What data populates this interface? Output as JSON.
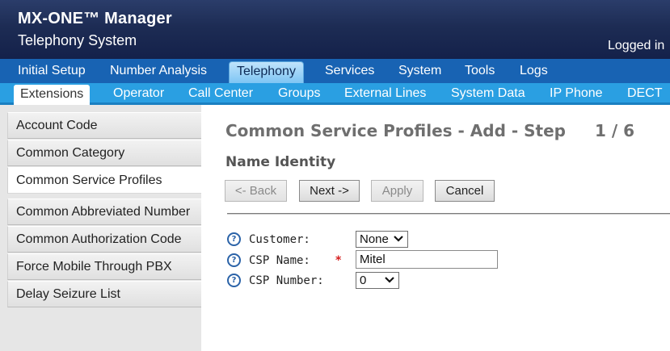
{
  "header": {
    "app_title": "MX-ONE™ Manager",
    "app_subtitle": "Telephony System",
    "logged_in": "Logged in"
  },
  "main_nav": [
    {
      "label": "Initial Setup",
      "active": false
    },
    {
      "label": "Number Analysis",
      "active": false
    },
    {
      "label": "Telephony",
      "active": true
    },
    {
      "label": "Services",
      "active": false
    },
    {
      "label": "System",
      "active": false
    },
    {
      "label": "Tools",
      "active": false
    },
    {
      "label": "Logs",
      "active": false
    }
  ],
  "sub_nav": [
    {
      "label": "Extensions",
      "active": true
    },
    {
      "label": "Operator",
      "active": false
    },
    {
      "label": "Call Center",
      "active": false
    },
    {
      "label": "Groups",
      "active": false
    },
    {
      "label": "External Lines",
      "active": false
    },
    {
      "label": "System Data",
      "active": false
    },
    {
      "label": "IP Phone",
      "active": false
    },
    {
      "label": "DECT",
      "active": false
    }
  ],
  "sidebar": {
    "items": [
      {
        "label": "Account Code",
        "active": false
      },
      {
        "label": "Common Category",
        "active": false
      },
      {
        "label": "Common Service Profiles",
        "active": true
      },
      {
        "label": "Common Abbreviated Number",
        "active": false
      },
      {
        "label": "Common Authorization Code",
        "active": false
      },
      {
        "label": "Force Mobile Through PBX",
        "active": false
      },
      {
        "label": "Delay Seizure List",
        "active": false
      }
    ]
  },
  "main": {
    "page_title": "Common Service Profiles - Add - Step",
    "step": "1 / 6",
    "section_title": "Name Identity",
    "buttons": {
      "back": "<- Back",
      "next": "Next ->",
      "apply": "Apply",
      "cancel": "Cancel"
    },
    "fields": {
      "customer": {
        "label": "Customer:",
        "value": "None"
      },
      "csp_name": {
        "label": "CSP Name:",
        "required_mark": "*",
        "value": "Mitel"
      },
      "csp_number": {
        "label": "CSP Number:",
        "value": "0"
      }
    },
    "help_glyph": "?"
  },
  "colors": {
    "header_bg": "#1d2c54",
    "main_nav_bg": "#1863b3",
    "sub_nav_bg": "#2a9fe2",
    "required": "#d62020",
    "help_icon": "#2b63a8"
  },
  "icons": {
    "help": "help-circle-icon",
    "dropdown": "chevron-down-icon"
  }
}
